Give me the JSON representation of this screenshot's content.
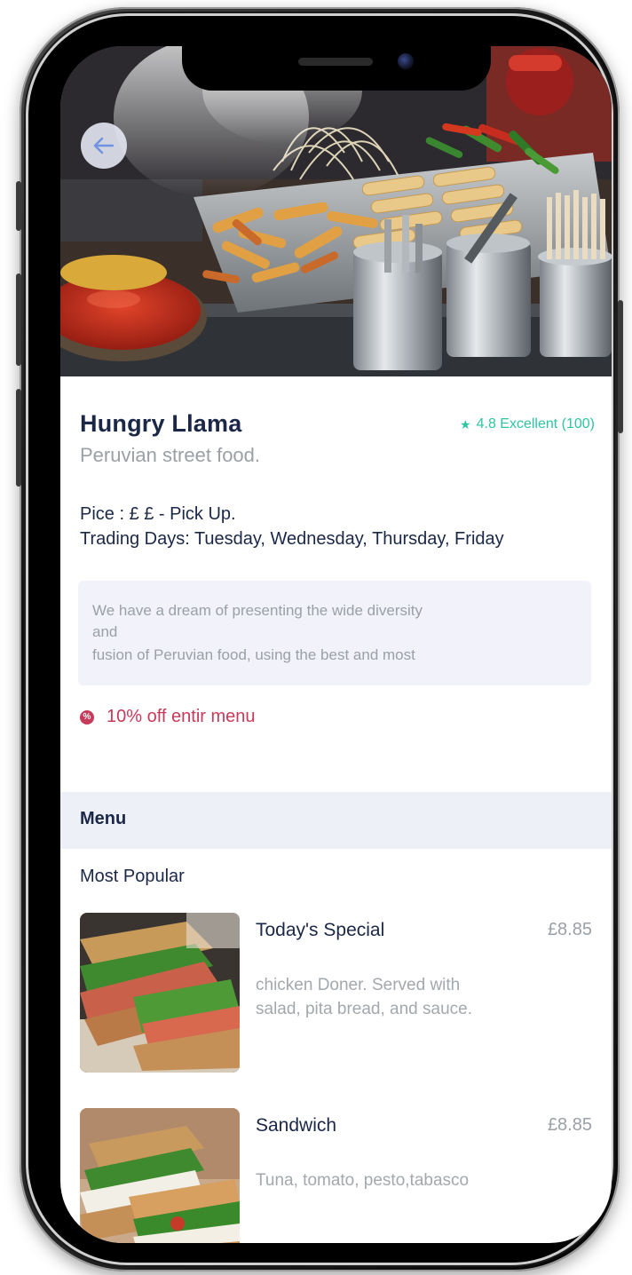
{
  "restaurant": {
    "name": "Hungry Llama",
    "tagline": "Peruvian street food.",
    "rating": "4.8 Excellent (100)",
    "price_line": "Pice : £ £ - Pick Up.",
    "trading_line": "Trading Days: Tuesday, Wednesday, Thursday, Friday",
    "description_lines": [
      "We have a dream of presenting the wide diversity",
      "and",
      "fusion of Peruvian food, using the best and most"
    ],
    "promo": "10% off entir menu"
  },
  "menu": {
    "title": "Menu",
    "section": "Most Popular",
    "items": [
      {
        "name": "Today's Special",
        "price": "£8.85",
        "description": "chicken Doner.  Served with salad, pita bread, and sauce."
      },
      {
        "name": "Sandwich",
        "price": "£8.85",
        "description": "Tuna, tomato, pesto,tabasco"
      }
    ]
  },
  "icons": {
    "back": "arrow-left-icon",
    "rating": "star-icon",
    "promo": "discount-icon"
  },
  "colors": {
    "primary_text": "#1b2747",
    "muted_text": "#9aa0a6",
    "rating": "#2ec4a2",
    "promo": "#c63a5a",
    "menu_bar": "#eef0f8",
    "description_box": "#f2f3fa",
    "back_arrow": "#6f93e0"
  }
}
